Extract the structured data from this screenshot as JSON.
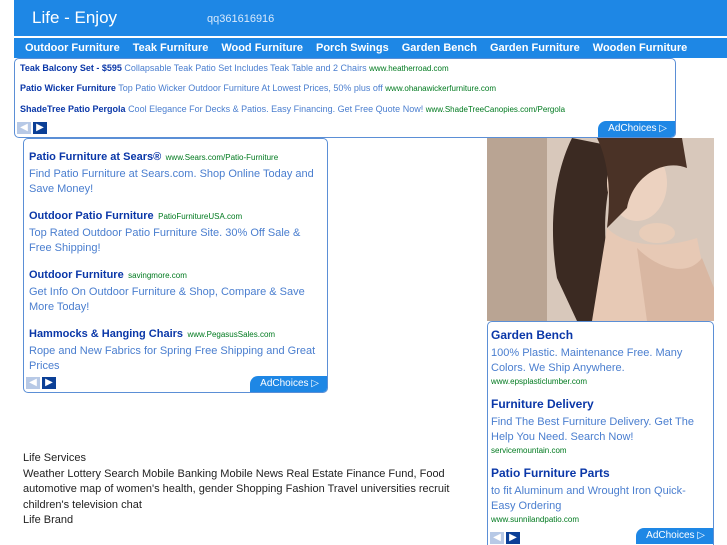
{
  "header": {
    "title": "Life - Enjoy",
    "qq": "qq361616916"
  },
  "nav": [
    "Outdoor Furniture",
    "Teak Furniture",
    "Wood Furniture",
    "Porch Swings",
    "Garden Bench",
    "Garden Furniture",
    "Wooden Furniture"
  ],
  "top_ads": [
    {
      "title": "Teak Balcony Set - $595",
      "desc": "Collapsable Teak Patio Set Includes Teak Table and 2 Chairs",
      "url": "www.heatherroad.com"
    },
    {
      "title": "Patio Wicker Furniture",
      "desc": "Top Patio Wicker Outdoor Furniture At Lowest Prices, 50% plus off",
      "url": "www.ohanawickerfurniture.com"
    },
    {
      "title": "ShadeTree Patio Pergola",
      "desc": "Cool Elegance For Decks & Patios. Easy Financing. Get Free Quote Now!",
      "url": "www.ShadeTreeCanopies.com/Pergola"
    }
  ],
  "left_ads": [
    {
      "title": "Patio Furniture at Sears®",
      "url": "www.Sears.com/Patio-Furniture",
      "desc": "Find Patio Furniture at Sears.com. Shop Online Today and Save Money!"
    },
    {
      "title": "Outdoor Patio Furniture",
      "url": "PatioFurnitureUSA.com",
      "desc": "Top Rated Outdoor Patio Furniture Site. 30% Off Sale & Free Shipping!"
    },
    {
      "title": "Outdoor Furniture",
      "url": "savingmore.com",
      "desc": "Get Info On Outdoor Furniture & Shop, Compare & Save More Today!"
    },
    {
      "title": "Hammocks & Hanging Chairs",
      "url": "www.PegasusSales.com",
      "desc": "Rope and New Fabrics for Spring Free Shipping and Great Prices"
    }
  ],
  "right_ads": [
    {
      "title": "Garden Bench",
      "desc": "100% Plastic. Maintenance Free. Many Colors. We Ship Anywhere.",
      "url": "www.epsplasticlumber.com"
    },
    {
      "title": "Furniture Delivery",
      "desc": "Find The Best Furniture Delivery. Get The Help You Need. Search Now!",
      "url": "servicemountain.com"
    },
    {
      "title": "Patio Furniture Parts",
      "desc": "to fit Aluminum and Wrought Iron Quick-Easy Ordering",
      "url": "www.sunnilandpatio.com"
    }
  ],
  "adchoices": "AdChoices ▷",
  "arrows": {
    "prev": "◀",
    "next": "▶"
  },
  "services": {
    "heading": "Life Services",
    "text": "Weather Lottery Search Mobile Banking Mobile News Real Estate Finance Fund, Food automotive map of women's health, gender Shopping Fashion Travel universities recruit children's television chat",
    "brand": "Life Brand"
  },
  "colors": {
    "header_bg": "#1e87e5",
    "ad_title": "#0a37a8",
    "ad_desc": "#4a7ecf",
    "ad_url": "#007a1f"
  }
}
